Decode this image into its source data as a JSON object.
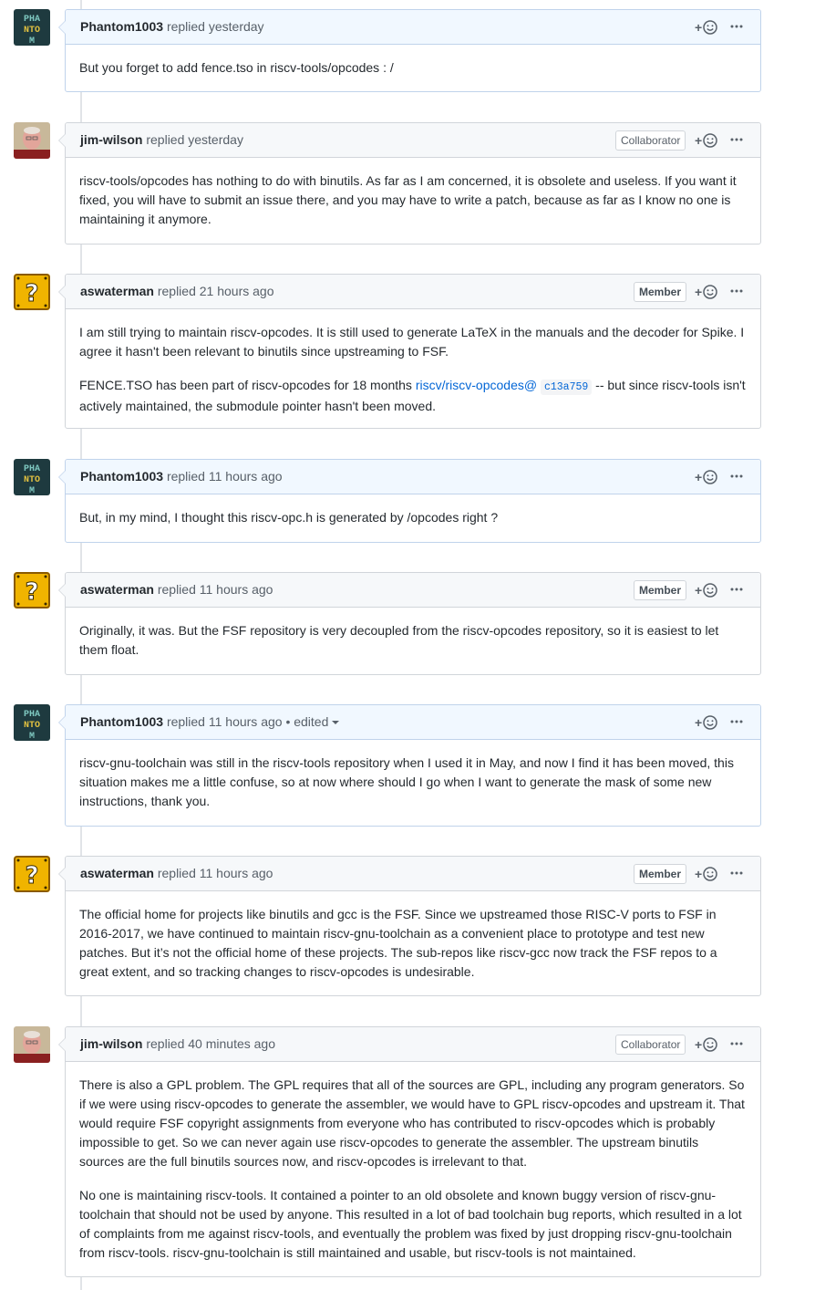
{
  "comments": [
    {
      "author": "Phantom1003",
      "meta": "replied yesterday",
      "edited": "",
      "badge": "",
      "avatar": "pixel-avatar",
      "paragraphs": [
        "But you forget to add fence.tso in riscv-tools/opcodes : /"
      ]
    },
    {
      "author": "jim-wilson",
      "meta": "replied yesterday",
      "edited": "",
      "badge": "Collaborator",
      "avatar": "photo-avatar",
      "paragraphs": [
        "riscv-tools/opcodes has nothing to do with binutils. As far as I am concerned, it is obsolete and useless. If you want it fixed, you will have to submit an issue there, and you may have to write a patch, because as far as I know no one is maintaining it anymore."
      ]
    },
    {
      "author": "aswaterman",
      "meta": "replied 21 hours ago",
      "edited": "",
      "badge": "Member",
      "avatar": "question-block-avatar",
      "paragraphs": [
        "I am still trying to maintain riscv-opcodes. It is still used to generate LaTeX in the manuals and the decoder for Spike. I agree it hasn't been relevant to binutils since upstreaming to FSF.",
        "FENCE.TSO has been part of riscv-opcodes for 18 months"
      ],
      "link_text": "riscv/riscv-opcodes@",
      "commit_sha": "c13a759",
      "link_suffix": "-- but since riscv-tools isn't actively maintained, the submodule pointer hasn't been moved."
    },
    {
      "author": "Phantom1003",
      "meta": "replied 11 hours ago",
      "edited": "",
      "badge": "",
      "avatar": "pixel-avatar",
      "paragraphs": [
        "But, in my mind, I thought this riscv-opc.h is generated by /opcodes right ?"
      ]
    },
    {
      "author": "aswaterman",
      "meta": "replied 11 hours ago",
      "edited": "",
      "badge": "Member",
      "avatar": "question-block-avatar",
      "paragraphs": [
        "Originally, it was. But the FSF repository is very decoupled from the riscv-opcodes repository, so it is easiest to let them float."
      ]
    },
    {
      "author": "Phantom1003",
      "meta": "replied 11 hours ago",
      "edited": "• edited",
      "badge": "",
      "avatar": "pixel-avatar",
      "paragraphs": [
        "riscv-gnu-toolchain was still in the riscv-tools repository when I used it in May, and now I find it has been moved, this situation makes me a little confuse, so at now where should I go when I want to generate the mask of some new instructions, thank you."
      ]
    },
    {
      "author": "aswaterman",
      "meta": "replied 11 hours ago",
      "edited": "",
      "badge": "Member",
      "avatar": "question-block-avatar",
      "paragraphs": [
        "The official home for projects like binutils and gcc is the FSF. Since we upstreamed those RISC-V ports to FSF in 2016-2017, we have continued to maintain riscv-gnu-toolchain as a convenient place to prototype and test new patches. But it’s not the official home of these projects. The sub-repos like riscv-gcc now track the FSF repos to a great extent, and so tracking changes to riscv-opcodes is undesirable."
      ]
    },
    {
      "author": "jim-wilson",
      "meta": "replied 40 minutes ago",
      "edited": "",
      "badge": "Collaborator",
      "avatar": "photo-avatar",
      "paragraphs": [
        "There is also a GPL problem. The GPL requires that all of the sources are GPL, including any program generators. So if we were using riscv-opcodes to generate the assembler, we would have to GPL riscv-opcodes and upstream it. That would require FSF copyright assignments from everyone who has contributed to riscv-opcodes which is probably impossible to get. So we can never again use riscv-opcodes to generate the assembler. The upstream binutils sources are the full binutils sources now, and riscv-opcodes is irrelevant to that.",
        "No one is maintaining riscv-tools. It contained a pointer to an old obsolete and known buggy version of riscv-gnu-toolchain that should not be used by anyone. This resulted in a lot of bad toolchain bug reports, which resulted in a lot of complaints from me against riscv-tools, and eventually the problem was fixed by just dropping riscv-gnu-toolchain from riscv-tools. riscv-gnu-toolchain is still maintained and usable, but riscv-tools is not maintained."
      ]
    }
  ],
  "colors": {
    "owner_header": "#f1f8ff",
    "owner_border": "#c0d3eb",
    "header": "#f6f8fa",
    "border": "#d1d5da",
    "link": "#0366d6"
  },
  "icons": {
    "reaction": "smiley-plus-icon",
    "more": "kebab-horizontal-icon"
  }
}
